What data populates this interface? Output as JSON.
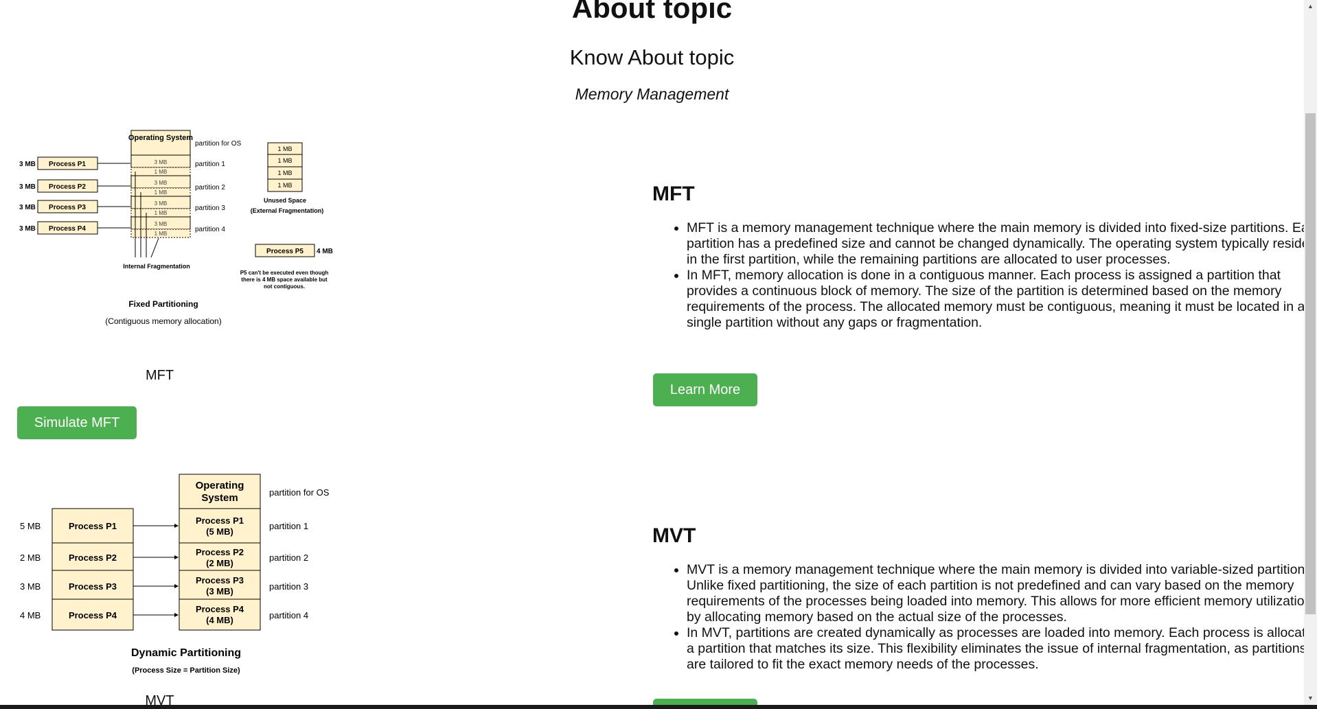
{
  "header": {
    "title": "About topic",
    "subtitle": "Know About topic",
    "topic": "Memory Management"
  },
  "mft_diagram": {
    "os_label": "Operating System",
    "os_side_label": "partition for OS",
    "sizes": [
      "3 MB",
      "3 MB",
      "3 MB",
      "3 MB"
    ],
    "processes": [
      "Process P1",
      "Process P2",
      "Process P3",
      "Process P4"
    ],
    "partition_blocks": [
      "3 MB",
      "1 MB",
      "3 MB",
      "1 MB",
      "3 MB",
      "1 MB",
      "3 MB",
      "1 MB"
    ],
    "partition_labels": [
      "partition 1",
      "partition 2",
      "partition 3",
      "partition 4"
    ],
    "unused_blocks": [
      "1 MB",
      "1 MB",
      "1 MB",
      "1 MB"
    ],
    "unused_label": "Unused Space",
    "unused_sub": "(External Fragmentation)",
    "p5_label": "Process P5",
    "p5_size": "4 MB",
    "internal_frag": "Internal Fragmentation",
    "p5_note_1": "P5 can't be executed even though",
    "p5_note_2": "there is 4 MB space available but",
    "p5_note_3": "not contiguous.",
    "title": "Fixed Partitioning",
    "subtitle": "(Contiguous memory allocation)"
  },
  "mvt_diagram": {
    "os_label_1": "Operating",
    "os_label_2": "System",
    "os_side_label": "partition for OS",
    "sizes": [
      "5 MB",
      "2 MB",
      "3 MB",
      "4 MB"
    ],
    "processes": [
      "Process P1",
      "Process P2",
      "Process P3",
      "Process P4"
    ],
    "partition_names": [
      "Process P1",
      "Process P2",
      "Process P3",
      "Process P4"
    ],
    "partition_sizes": [
      "(5 MB)",
      "(2 MB)",
      "(3 MB)",
      "(4 MB)"
    ],
    "partition_labels": [
      "partition 1",
      "partition 2",
      "partition 3",
      "partition 4"
    ],
    "title": "Dynamic Partitioning",
    "subtitle": "(Process Size = Partition Size)"
  },
  "mft": {
    "caption": "MFT",
    "simulate_label": "Simulate MFT",
    "heading": "MFT",
    "bullets": [
      "MFT is a memory management technique where the main memory is divided into fixed-size partitions. Each partition has a predefined size and cannot be changed dynamically. The operating system typically resides in the first partition, while the remaining partitions are allocated to user processes.",
      "In MFT, memory allocation is done in a contiguous manner. Each process is assigned a partition that provides a continuous block of memory. The size of the partition is determined based on the memory requirements of the process. The allocated memory must be contiguous, meaning it must be located in a single partition without any gaps or fragmentation."
    ],
    "learn_more_label": "Learn More"
  },
  "mvt": {
    "caption": "MVT",
    "heading": "MVT",
    "bullets": [
      "MVT is a memory management technique where the main memory is divided into variable-sized partitions. Unlike fixed partitioning, the size of each partition is not predefined and can vary based on the memory requirements of the processes being loaded into memory. This allows for more efficient memory utilization by allocating memory based on the actual size of the processes.",
      "In MVT, partitions are created dynamically as processes are loaded into memory. Each process is allocated a partition that matches its size. This flexibility eliminates the issue of internal fragmentation, as partitions are tailored to fit the exact memory needs of the processes."
    ]
  },
  "colors": {
    "button_green": "#4caf50",
    "block_fill": "#fff2cc"
  }
}
